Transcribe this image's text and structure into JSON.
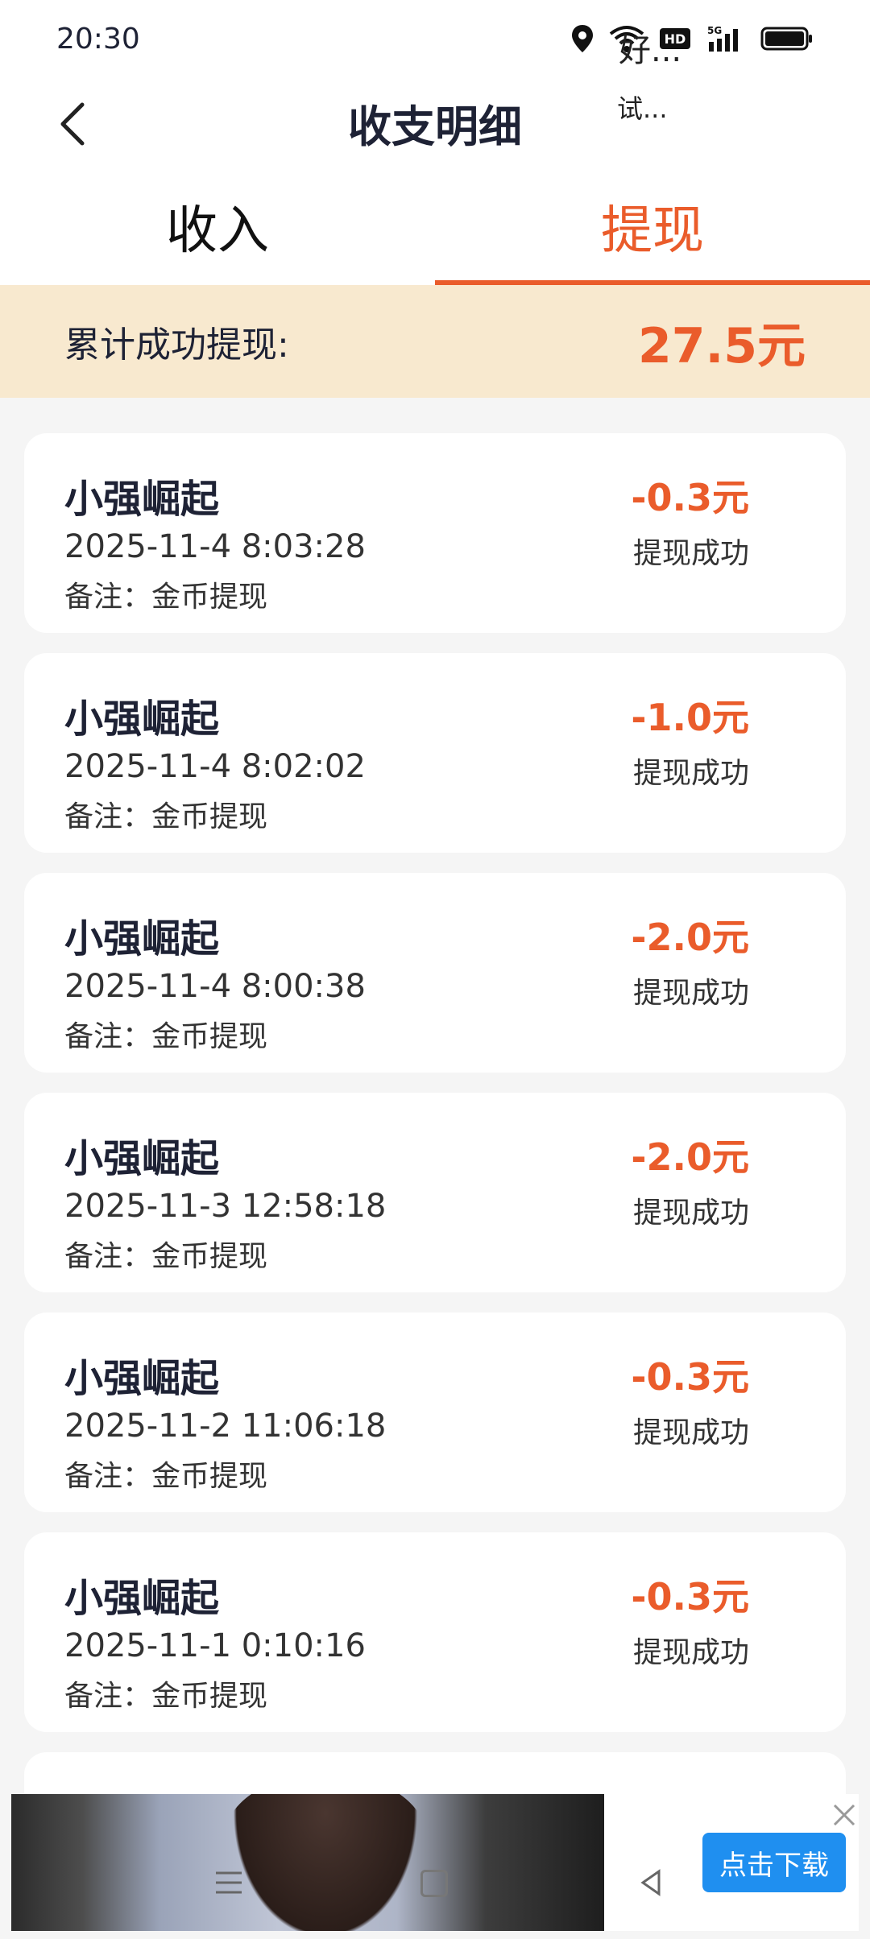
{
  "status_bar": {
    "time": "20:30",
    "network": "5G"
  },
  "header": {
    "title": "收支明细"
  },
  "tabs": [
    {
      "label": "收入",
      "active": false
    },
    {
      "label": "提现",
      "active": true
    }
  ],
  "summary": {
    "label": "累计成功提现:",
    "amount": "27.5元"
  },
  "records": [
    {
      "name": "小强崛起",
      "date": "2025-11-4 8:03:28",
      "note": "备注：金币提现",
      "amount": "-0.3元",
      "status": "提现成功"
    },
    {
      "name": "小强崛起",
      "date": "2025-11-4 8:02:02",
      "note": "备注：金币提现",
      "amount": "-1.0元",
      "status": "提现成功"
    },
    {
      "name": "小强崛起",
      "date": "2025-11-4 8:00:38",
      "note": "备注：金币提现",
      "amount": "-2.0元",
      "status": "提现成功"
    },
    {
      "name": "小强崛起",
      "date": "2025-11-3 12:58:18",
      "note": "备注：金币提现",
      "amount": "-2.0元",
      "status": "提现成功"
    },
    {
      "name": "小强崛起",
      "date": "2025-11-2 11:06:18",
      "note": "备注：金币提现",
      "amount": "-0.3元",
      "status": "提现成功"
    },
    {
      "name": "小强崛起",
      "date": "2025-11-1 0:10:16",
      "note": "备注：金币提现",
      "amount": "-0.3元",
      "status": "提现成功"
    }
  ],
  "ad": {
    "title": "好...",
    "subtitle": "试...",
    "button": "点击下载"
  },
  "colors": {
    "accent": "#ea5c2b",
    "summary_bg": "#f8e9cf",
    "ad_button": "#1f8ff0"
  }
}
